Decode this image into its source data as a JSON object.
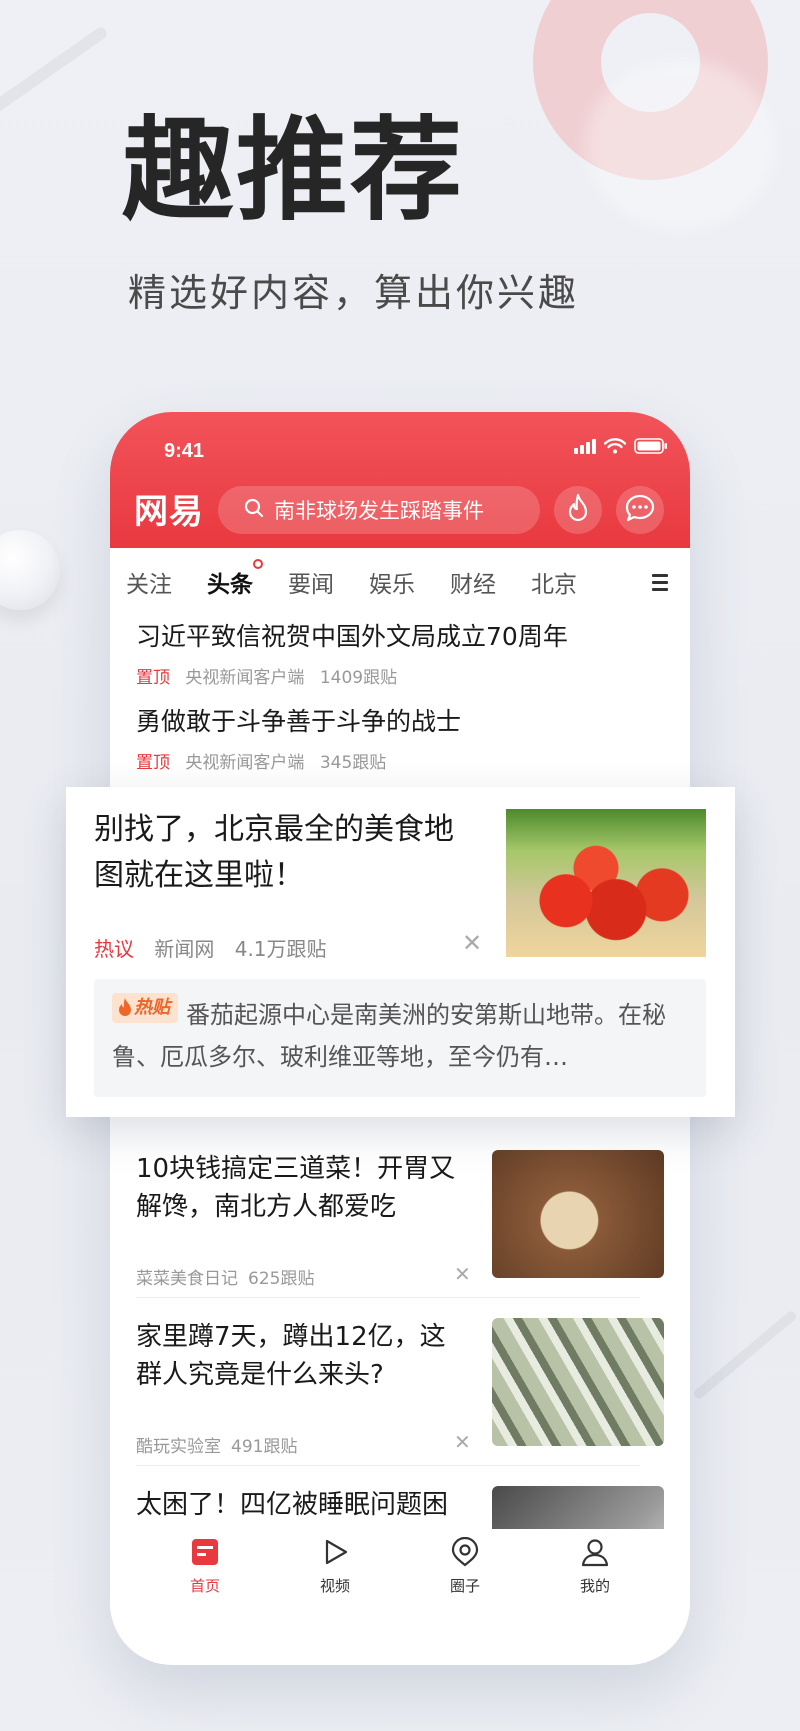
{
  "hero": {
    "title": "趣推荐",
    "subtitle": "精选好内容，算出你兴趣"
  },
  "status_bar": {
    "time": "9:41"
  },
  "header": {
    "logo": "网易",
    "search_placeholder": "南非球场发生踩踏事件"
  },
  "tabs": [
    {
      "label": "关注"
    },
    {
      "label": "头条"
    },
    {
      "label": "要闻"
    },
    {
      "label": "娱乐"
    },
    {
      "label": "财经"
    },
    {
      "label": "北京"
    }
  ],
  "top_news": [
    {
      "title": "习近平致信祝贺中国外文局成立70周年",
      "tag": "置顶",
      "source": "央视新闻客户端",
      "comments": "1409跟贴"
    },
    {
      "title": "勇做敢于斗争善于斗争的战士",
      "tag": "置顶",
      "source": "央视新闻客户端",
      "comments": "345跟贴"
    }
  ],
  "featured": {
    "title": "别找了，北京最全的美食地图就在这里啦！",
    "tag": "热议",
    "source": "新闻网",
    "comments": "4.1万跟贴",
    "hot_comment_tag": "热贴",
    "hot_comment": "番茄起源中心是南美洲的安第斯山地带。在秘鲁、厄瓜多尔、玻利维亚等地，至今仍有…"
  },
  "feed": [
    {
      "title": "10块钱搞定三道菜！开胃又解馋，南北方人都爱吃",
      "source": "菜菜美食日记",
      "comments": "625跟贴"
    },
    {
      "title": "家里蹲7天，蹲出12亿，这群人究竟是什么来头?",
      "source": "酷玩实验室",
      "comments": "491跟贴"
    },
    {
      "title": "太困了！四亿被睡眠问题困"
    }
  ],
  "bottom_nav": [
    {
      "label": "首页"
    },
    {
      "label": "视频"
    },
    {
      "label": "圈子"
    },
    {
      "label": "我的"
    }
  ],
  "colors": {
    "brand_red": "#e8393f",
    "hot_orange": "#f0662a"
  },
  "icons": [
    "search-icon",
    "fire-icon",
    "chat-icon",
    "menu-icon",
    "close-icon",
    "home-icon",
    "video-icon",
    "circle-icon",
    "profile-icon"
  ]
}
